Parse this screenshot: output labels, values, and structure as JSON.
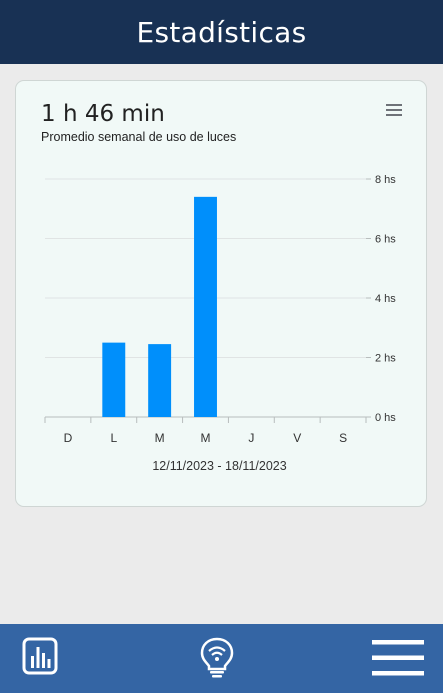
{
  "header": {
    "title": "Estadísticas"
  },
  "card": {
    "value": "1 h 46 min",
    "subtitle": "Promedio semanal de uso de luces",
    "menu_icon": "hamburger-menu-icon"
  },
  "chart_data": {
    "type": "bar",
    "categories": [
      "D",
      "L",
      "M",
      "M",
      "J",
      "V",
      "S"
    ],
    "values": [
      0,
      2.5,
      2.45,
      7.4,
      0,
      0,
      0
    ],
    "ylim": [
      0,
      8
    ],
    "yticks": [
      0,
      2,
      4,
      6,
      8
    ],
    "ytick_labels": [
      "0 hs",
      "2 hs",
      "4 hs",
      "6 hs",
      "8 hs"
    ],
    "xlabel": "12/11/2023 - 18/11/2023",
    "grid": true,
    "bar_color": "#008ffb",
    "axis_position": "right"
  },
  "bottom_nav": {
    "items": [
      {
        "icon": "bar-chart-icon"
      },
      {
        "icon": "smart-bulb-icon"
      },
      {
        "icon": "menu-icon"
      }
    ],
    "background": "#3465a4"
  },
  "colors": {
    "header": "#183154",
    "accent": "#008ffb",
    "card_bg": "#f1f9f7"
  }
}
